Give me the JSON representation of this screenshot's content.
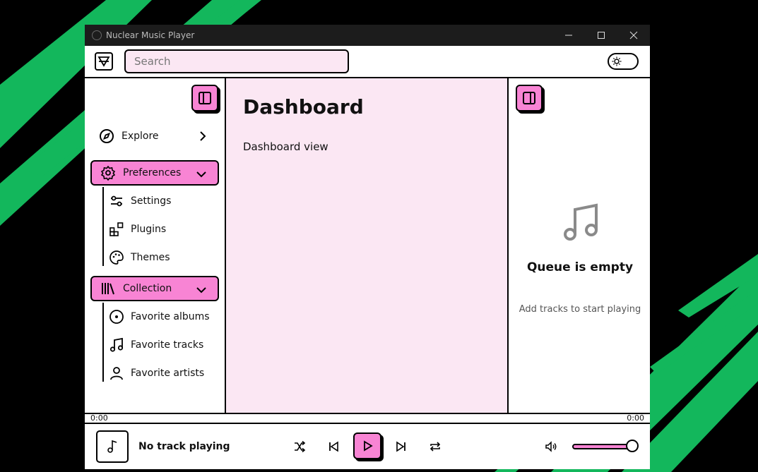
{
  "window": {
    "title": "Nuclear Music Player"
  },
  "search": {
    "placeholder": "Search"
  },
  "sidebar": {
    "explore_label": "Explore",
    "preferences_label": "Preferences",
    "preferences_items": [
      {
        "label": "Settings",
        "icon": "sliders-icon"
      },
      {
        "label": "Plugins",
        "icon": "puzzle-icon"
      },
      {
        "label": "Themes",
        "icon": "palette-icon"
      }
    ],
    "collection_label": "Collection",
    "collection_items": [
      {
        "label": "Favorite albums",
        "icon": "disc-icon"
      },
      {
        "label": "Favorite tracks",
        "icon": "music-note-icon"
      },
      {
        "label": "Favorite artists",
        "icon": "user-icon"
      }
    ]
  },
  "main": {
    "title": "Dashboard",
    "subtitle": "Dashboard view"
  },
  "queue": {
    "empty_title": "Queue is empty",
    "empty_subtitle": "Add tracks to start playing"
  },
  "player": {
    "time_current": "0:00",
    "time_total": "0:00",
    "track_label": "No track playing",
    "volume": 0.88
  },
  "colors": {
    "accent": "#f884d4",
    "surface": "#fbe7f3",
    "deco_green": "#1db954"
  }
}
